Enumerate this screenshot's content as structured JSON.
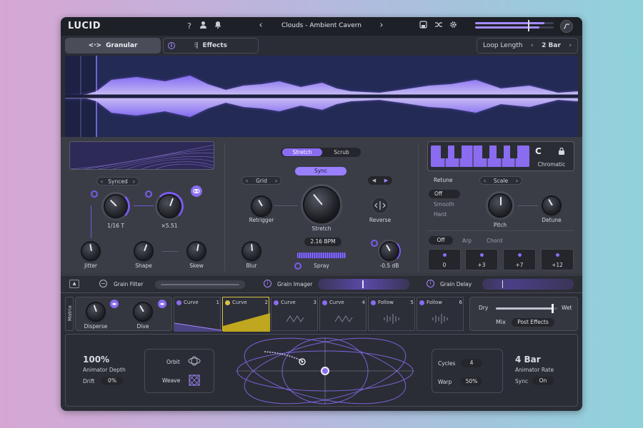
{
  "app": {
    "logo": "LUCID"
  },
  "topbar": {
    "help_icon": "?",
    "user_icon": "👤",
    "bell_icon": "🔔",
    "prev": "‹",
    "next": "›",
    "preset": "Clouds - Ambient Cavern",
    "save_icon": "💾",
    "shuffle_icon": "⤨",
    "gear_icon": "⚙",
    "output_level": 0.7
  },
  "tabs": {
    "granular": "Granular",
    "effects": "Effects",
    "granular_icon": "<·>",
    "info_icon": "i",
    "effects_icon": "⫶|"
  },
  "loop": {
    "label": "Loop Length",
    "value": "2 Bar"
  },
  "left": {
    "mode": "Synced",
    "knobs": [
      {
        "label": "1/16 T"
      },
      {
        "label": "×5.51"
      }
    ],
    "jitter": "Jitter",
    "shape": "Shape",
    "skew": "Skew"
  },
  "center": {
    "stretch_tab": "Stretch",
    "scrub_tab": "Scrub",
    "sync": "Sync",
    "grid": "Grid",
    "retrigger": "Retrigger",
    "stretch": "Stretch",
    "reverse": "Reverse",
    "bpm": "2.16 BPM",
    "blur": "Blur",
    "spray": "Spray",
    "gain": "-0.5 dB"
  },
  "right": {
    "key": "C",
    "scale_type": "Chromatic",
    "retune": "Retune",
    "scale": "Scale",
    "retune_opts": [
      "Off",
      "Smooth",
      "Hard"
    ],
    "pitch": "Pitch",
    "detune": "Detune",
    "modes": [
      "Off",
      "Arp",
      "Chord"
    ],
    "intervals": [
      "0",
      "+3",
      "+7",
      "+12"
    ]
  },
  "fxbar": {
    "grain_filter": "Grain Filter",
    "grain_imager": "Grain Imager",
    "grain_delay": "Grain Delay"
  },
  "matrix": {
    "label": "Matrix",
    "disperse": "Disperse",
    "dive": "Dive",
    "slots": [
      {
        "name": "Curve",
        "num": "1"
      },
      {
        "name": "Curve",
        "num": "2"
      },
      {
        "name": "Curve",
        "num": "3"
      },
      {
        "name": "Curve",
        "num": "4"
      },
      {
        "name": "Follow",
        "num": "5"
      },
      {
        "name": "Follow",
        "num": "6"
      }
    ],
    "dry": "Dry",
    "wet": "Wet",
    "mix": "Mix",
    "post": "Post Effects",
    "mix_value": 0.92
  },
  "animator": {
    "depth": "100%",
    "depth_label": "Animator Depth",
    "drift": "Drift",
    "drift_val": "0%",
    "orbit": "Orbit",
    "weave": "Weave",
    "cycles": "Cycles",
    "cycles_val": "4",
    "warp": "Warp",
    "warp_val": "50%",
    "rate": "4 Bar",
    "rate_label": "Animator Rate",
    "sync": "Sync",
    "sync_val": "On"
  }
}
